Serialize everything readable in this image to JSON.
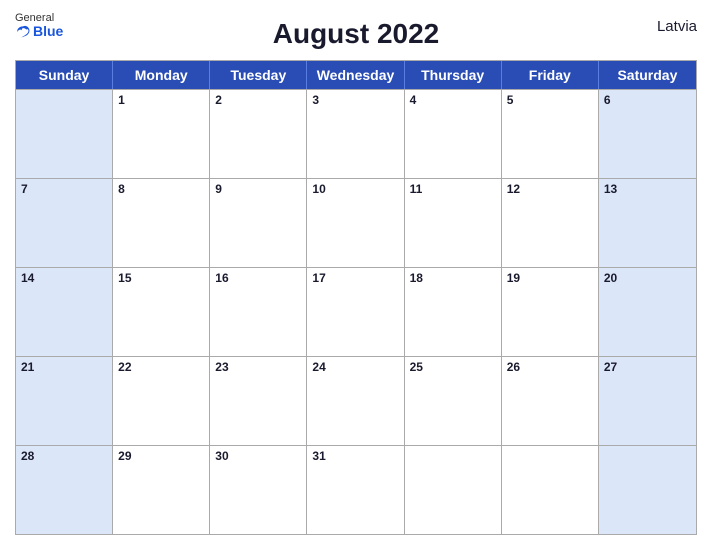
{
  "header": {
    "title": "August 2022",
    "country": "Latvia",
    "logo": {
      "general": "General",
      "blue": "Blue"
    }
  },
  "days": {
    "headers": [
      "Sunday",
      "Monday",
      "Tuesday",
      "Wednesday",
      "Thursday",
      "Friday",
      "Saturday"
    ]
  },
  "weeks": [
    [
      {
        "num": "",
        "empty": true
      },
      {
        "num": "1"
      },
      {
        "num": "2"
      },
      {
        "num": "3"
      },
      {
        "num": "4"
      },
      {
        "num": "5"
      },
      {
        "num": "6"
      }
    ],
    [
      {
        "num": "7"
      },
      {
        "num": "8"
      },
      {
        "num": "9"
      },
      {
        "num": "10"
      },
      {
        "num": "11"
      },
      {
        "num": "12"
      },
      {
        "num": "13"
      }
    ],
    [
      {
        "num": "14"
      },
      {
        "num": "15"
      },
      {
        "num": "16"
      },
      {
        "num": "17"
      },
      {
        "num": "18"
      },
      {
        "num": "19"
      },
      {
        "num": "20"
      }
    ],
    [
      {
        "num": "21"
      },
      {
        "num": "22"
      },
      {
        "num": "23"
      },
      {
        "num": "24"
      },
      {
        "num": "25"
      },
      {
        "num": "26"
      },
      {
        "num": "27"
      }
    ],
    [
      {
        "num": "28"
      },
      {
        "num": "29"
      },
      {
        "num": "30"
      },
      {
        "num": "31"
      },
      {
        "num": "",
        "empty": true
      },
      {
        "num": "",
        "empty": true
      },
      {
        "num": "",
        "empty": true
      }
    ]
  ]
}
